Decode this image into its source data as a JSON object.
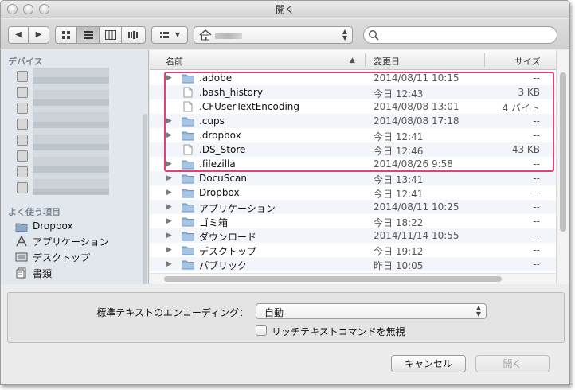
{
  "window": {
    "title": "開く"
  },
  "toolbar": {
    "search_placeholder": ""
  },
  "sidebar": {
    "devices_heading": "デバイス",
    "favorites_heading": "よく使う項目",
    "favorites": [
      {
        "label": "Dropbox",
        "icon": "folder-icon"
      },
      {
        "label": "アプリケーション",
        "icon": "applications-icon"
      },
      {
        "label": "デスクトップ",
        "icon": "desktop-icon"
      },
      {
        "label": "書類",
        "icon": "documents-icon"
      }
    ]
  },
  "columns": {
    "name": "名前",
    "modified": "変更日",
    "size": "サイズ"
  },
  "files": [
    {
      "name": ".adobe",
      "date": "2014/08/11 10:15",
      "size": "--",
      "kind": "folder",
      "expandable": true
    },
    {
      "name": ".bash_history",
      "date": "今日 12:43",
      "size": "3 KB",
      "kind": "file",
      "expandable": false
    },
    {
      "name": ".CFUserTextEncoding",
      "date": "2014/08/08 13:01",
      "size": "4 バイト",
      "kind": "file",
      "expandable": false
    },
    {
      "name": ".cups",
      "date": "2014/08/08 17:18",
      "size": "--",
      "kind": "folder",
      "expandable": true
    },
    {
      "name": ".dropbox",
      "date": "今日 12:41",
      "size": "--",
      "kind": "folder",
      "expandable": true
    },
    {
      "name": ".DS_Store",
      "date": "今日 12:46",
      "size": "43 KB",
      "kind": "file",
      "expandable": false
    },
    {
      "name": ".filezilla",
      "date": "2014/08/26 9:58",
      "size": "--",
      "kind": "folder",
      "expandable": true
    },
    {
      "name": "DocuScan",
      "date": "今日 13:41",
      "size": "--",
      "kind": "folder",
      "expandable": true
    },
    {
      "name": "Dropbox",
      "date": "今日 12:41",
      "size": "--",
      "kind": "folder",
      "expandable": true
    },
    {
      "name": "アプリケーション",
      "date": "2014/08/11 10:25",
      "size": "--",
      "kind": "folder",
      "expandable": true
    },
    {
      "name": "ゴミ箱",
      "date": "今日 18:22",
      "size": "--",
      "kind": "folder",
      "expandable": true
    },
    {
      "name": "ダウンロード",
      "date": "2014/11/14 10:55",
      "size": "--",
      "kind": "folder",
      "expandable": true
    },
    {
      "name": "デスクトップ",
      "date": "今日 19:12",
      "size": "--",
      "kind": "folder",
      "expandable": true
    },
    {
      "name": "パブリック",
      "date": "昨日 10:05",
      "size": "--",
      "kind": "folder",
      "expandable": true
    }
  ],
  "options": {
    "encoding_label": "標準テキストのエンコーディング：",
    "encoding_value": "自動",
    "ignore_rich_text_label": "リッチテキストコマンドを無視",
    "ignore_rich_text_checked": false
  },
  "buttons": {
    "cancel": "キャンセル",
    "open": "開く"
  },
  "colors": {
    "highlight": "#e3407a",
    "folder": "#8fb4d9",
    "sidebar_bg": "#e2e7ed"
  }
}
